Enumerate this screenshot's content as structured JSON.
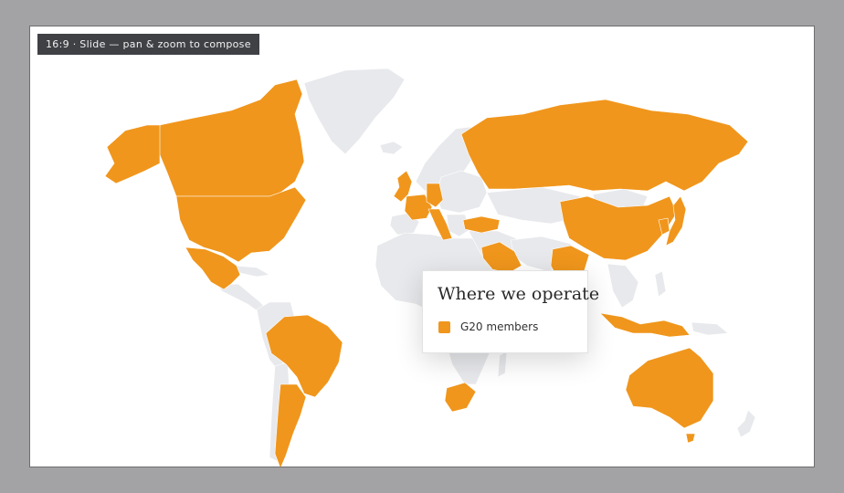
{
  "slide": {
    "badge": "16:9 · Slide — pan & zoom to compose"
  },
  "legend": {
    "title": "Where we operate",
    "items": [
      {
        "label": "G20 members",
        "color": "#f0961c"
      }
    ]
  },
  "map": {
    "highlight_color": "#f0961c",
    "base_color": "#e8e9ec",
    "background": "#ffffff",
    "highlighted_countries": [
      "Argentina",
      "Australia",
      "Brazil",
      "Canada",
      "China",
      "France",
      "Germany",
      "India",
      "Indonesia",
      "Italy",
      "Japan",
      "Mexico",
      "Russia",
      "Saudi Arabia",
      "South Africa",
      "South Korea",
      "Turkey",
      "United Kingdom",
      "United States"
    ]
  }
}
